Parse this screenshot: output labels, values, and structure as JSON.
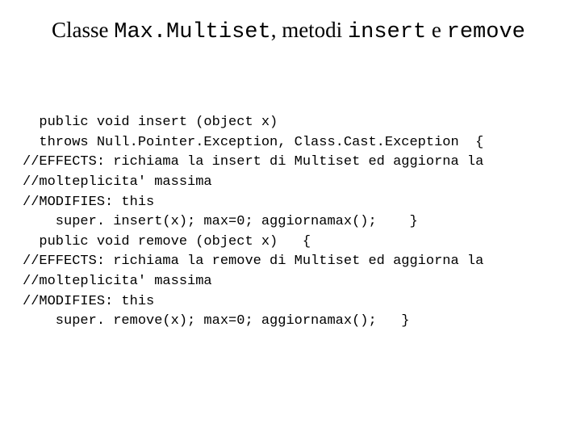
{
  "title": {
    "p1": "Classe ",
    "p2": "Max.Multiset",
    "p3": ", metodi ",
    "p4": "insert",
    "p5": " e ",
    "p6": "remove"
  },
  "code": {
    "l1": "  public void insert (object x)",
    "l2": "  throws Null.Pointer.Exception, Class.Cast.Exception  {",
    "l3": "//EFFECTS: richiama la insert di Multiset ed aggiorna la",
    "l4": "//molteplicita' massima",
    "l5": "//MODIFIES: this",
    "l6": "    super. insert(x); max=0; aggiornamax();    }",
    "l7": "  public void remove (object x)   {",
    "l8": "//EFFECTS: richiama la remove di Multiset ed aggiorna la",
    "l9": "//molteplicita' massima",
    "l10": "//MODIFIES: this",
    "l11": "    super. remove(x); max=0; aggiornamax();   }"
  }
}
